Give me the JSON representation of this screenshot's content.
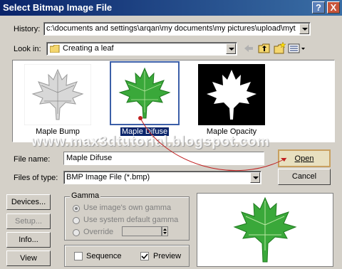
{
  "window": {
    "title": "Select Bitmap Image File",
    "help_label": "?",
    "close_label": "X"
  },
  "history": {
    "label": "History:",
    "value": "c:\\documents and settings\\arqan\\my documents\\my pictures\\upload\\mytutc"
  },
  "look_in": {
    "label": "Look in:",
    "value": "Creating a leaf"
  },
  "files": [
    {
      "label": "Maple Bump"
    },
    {
      "label": "Maple Difuse"
    },
    {
      "label": "Maple Opacity"
    }
  ],
  "watermark": "www.max3dtutorial.blogspot.com",
  "file_name": {
    "label": "File name:",
    "value": "Maple Difuse"
  },
  "files_of_type": {
    "label": "Files of type:",
    "value": "BMP Image File (*.bmp)"
  },
  "buttons": {
    "open": "Open",
    "cancel": "Cancel",
    "devices": "Devices...",
    "setup": "Setup...",
    "info": "Info...",
    "view": "View"
  },
  "gamma": {
    "title": "Gamma",
    "own": "Use image's own gamma",
    "system": "Use system default gamma",
    "override": "Override"
  },
  "options": {
    "sequence": "Sequence",
    "preview": "Preview",
    "preview_checked": true,
    "sequence_checked": false
  },
  "colors": {
    "titlebar": "#0a246a",
    "selection": "#0a246a",
    "leaf_green": "#3aa83a",
    "annotation_red": "#c02020"
  }
}
